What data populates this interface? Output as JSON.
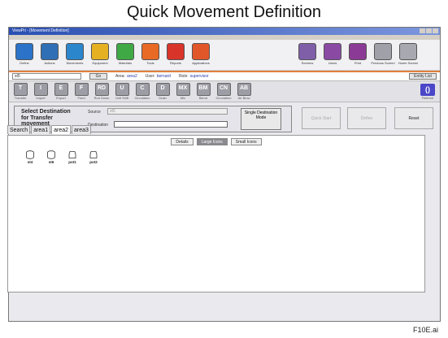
{
  "figure": {
    "title": "Quick Movement Definition",
    "figure_id": "F10E.ai"
  },
  "window": {
    "title": "ViewPri - [Movement Definition]"
  },
  "toolbar": {
    "left": [
      {
        "label": "Define",
        "color": "#2a73c8",
        "icon": "define-icon"
      },
      {
        "label": "Actions",
        "color": "#2f6fb6",
        "icon": "actions-icon"
      },
      {
        "label": "Movements",
        "color": "#2b86cc",
        "icon": "movements-icon"
      },
      {
        "label": "Equipment",
        "color": "#e5b021",
        "icon": "equipment-icon"
      },
      {
        "label": "Materials",
        "color": "#3fa946",
        "icon": "materials-icon"
      },
      {
        "label": "Tools",
        "color": "#e86a24",
        "icon": "tools-icon"
      },
      {
        "label": "Reports",
        "color": "#d9342a",
        "icon": "reports-icon"
      },
      {
        "label": "Applications",
        "color": "#e2572a",
        "icon": "applications-icon"
      }
    ],
    "right": [
      {
        "label": "Screens",
        "color": "#7e5fa8",
        "icon": "screens-icon"
      },
      {
        "label": "Users",
        "color": "#8a4aa4",
        "icon": "users-icon"
      },
      {
        "label": "Print",
        "color": "#8b3b95",
        "icon": "print-icon"
      },
      {
        "label": "Previous Screen",
        "color": "#a0a0a8",
        "icon": "previous-screen-icon"
      },
      {
        "label": "Home Screen",
        "color": "#a8a8b0",
        "icon": "home-screen-icon"
      }
    ]
  },
  "infobar": {
    "entity_value": "st5",
    "go_label": "Go",
    "area_label": "Area:",
    "area_value": "area2",
    "user_label": "User:",
    "user_value": "bernard",
    "role_label": "Role:",
    "role_value": "supervisor",
    "entity_list_label": "Entity List"
  },
  "type_buttons": [
    {
      "letter": "T",
      "label": "Transfer"
    },
    {
      "letter": "I",
      "label": "Import"
    },
    {
      "letter": "E",
      "label": "Export"
    },
    {
      "letter": "F",
      "label": "Feed"
    },
    {
      "letter": "RD",
      "label": "Run Down"
    },
    {
      "letter": "U",
      "label": "Unit Shift"
    },
    {
      "letter": "C",
      "label": "Circulation"
    },
    {
      "letter": "D",
      "label": "Drain"
    },
    {
      "letter": "MX",
      "label": "Mix"
    },
    {
      "letter": "BM",
      "label": "Blend"
    },
    {
      "letter": "CN",
      "label": "Circulation"
    },
    {
      "letter": "AB",
      "label": "Air Blow"
    }
  ],
  "refresh": {
    "label": "Refresh"
  },
  "destination_panel": {
    "heading": "Select Destination for Transfer movement",
    "source_label": "Source",
    "source_value": "st5",
    "destination_label": "Destination",
    "destination_value": "",
    "single_mode_label": "Single Destination Mode"
  },
  "actions": {
    "quick_start": "Quick Start",
    "define": "Define",
    "reset": "Reset"
  },
  "tabs": [
    {
      "label": "Search",
      "active": false
    },
    {
      "label": "area1",
      "active": false
    },
    {
      "label": "area2",
      "active": true
    },
    {
      "label": "area3",
      "active": false
    }
  ],
  "view_options": [
    {
      "label": "Details",
      "active": false
    },
    {
      "label": "Large Icons",
      "active": true
    },
    {
      "label": "Small Icons",
      "active": false
    }
  ],
  "equipment": [
    {
      "name": "st4",
      "type": "tank"
    },
    {
      "name": "st6",
      "type": "tank"
    },
    {
      "name": "pot1",
      "type": "pot"
    },
    {
      "name": "pot2",
      "type": "pot"
    }
  ]
}
